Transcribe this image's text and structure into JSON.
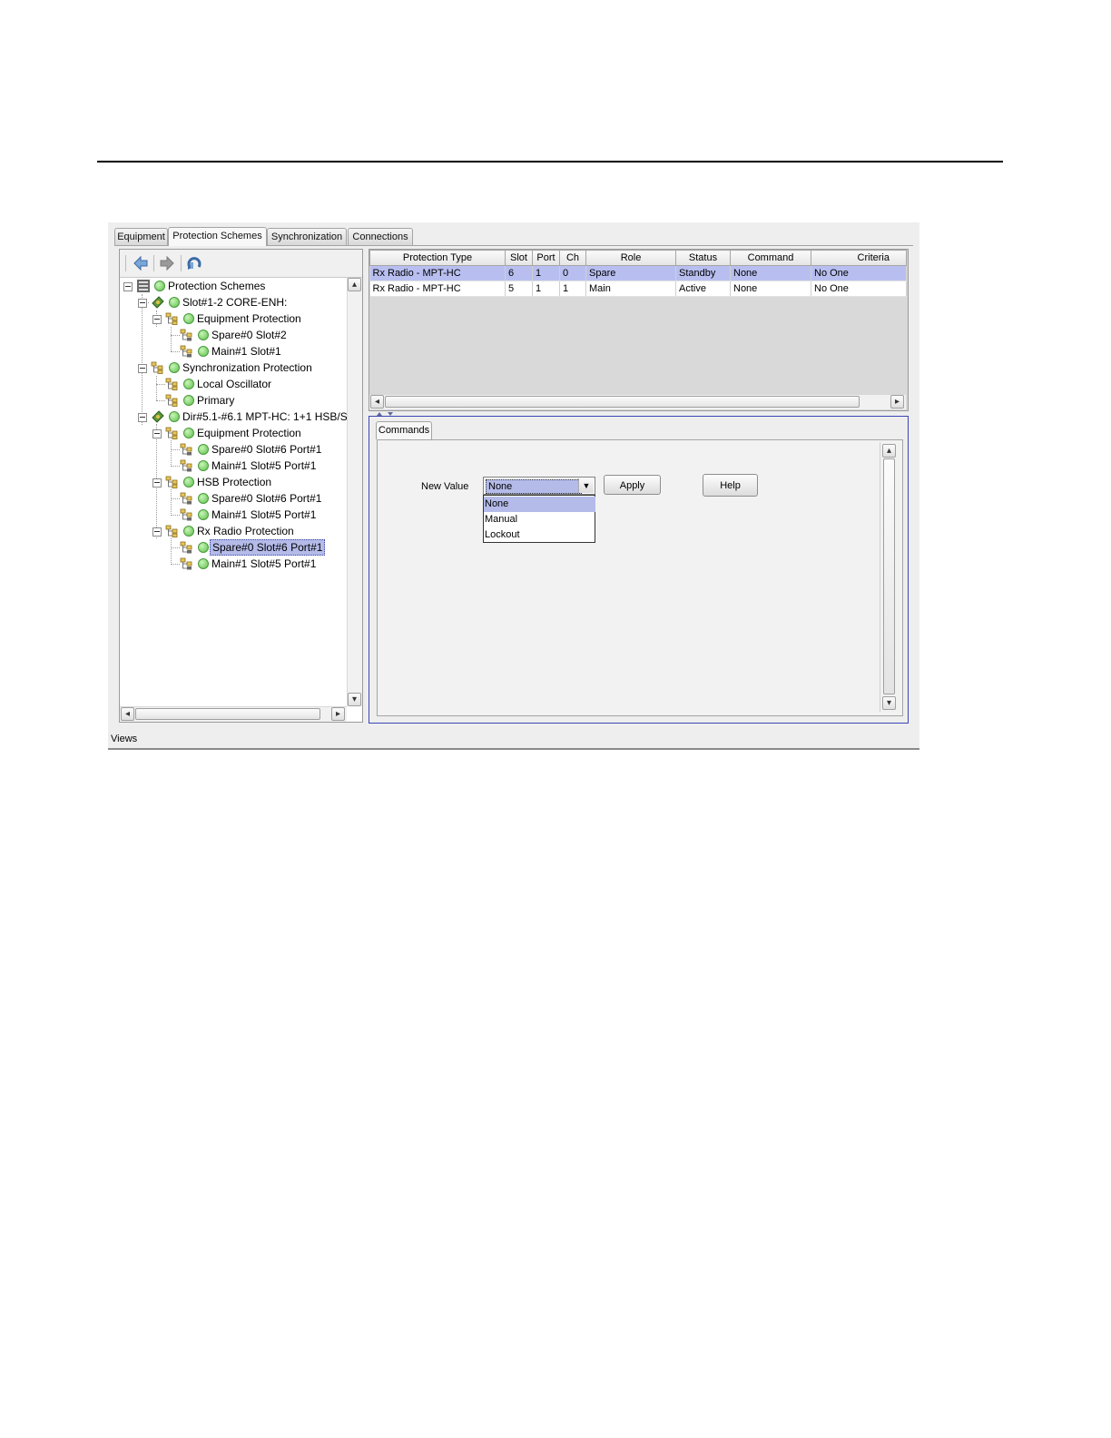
{
  "tabs": [
    "Equipment",
    "Protection Schemes",
    "Synchronization",
    "Connections"
  ],
  "active_tab": "Protection Schemes",
  "tree": {
    "root": "Protection Schemes",
    "nodes": [
      "Slot#1-2  CORE-ENH:",
      "Equipment Protection",
      "Spare#0 Slot#2",
      "Main#1 Slot#1",
      "Synchronization Protection",
      "Local Oscillator",
      "Primary",
      "Dir#5.1-#6.1  MPT-HC: 1+1 HSB/S",
      "Equipment Protection",
      "Spare#0 Slot#6 Port#1",
      "Main#1 Slot#5 Port#1",
      "HSB Protection",
      "Spare#0 Slot#6 Port#1",
      "Main#1 Slot#5 Port#1",
      "Rx Radio Protection",
      "Spare#0 Slot#6 Port#1",
      "Main#1 Slot#5 Port#1"
    ],
    "selected": "Spare#0 Slot#6 Port#1"
  },
  "table": {
    "columns": [
      "Protection Type",
      "Slot",
      "Port",
      "Ch",
      "Role",
      "Status",
      "Command",
      "Criteria"
    ],
    "rows": [
      [
        "Rx Radio - MPT-HC",
        "6",
        "1",
        "0",
        "Spare",
        "Standby",
        "None",
        "No One"
      ],
      [
        "Rx Radio - MPT-HC",
        "5",
        "1",
        "1",
        "Main",
        "Active",
        "None",
        "No One"
      ]
    ]
  },
  "commands": {
    "tab_label": "Commands",
    "new_value_label": "New Value",
    "selected_value": "None",
    "options": [
      "None",
      "Manual",
      "Lockout"
    ],
    "apply_label": "Apply",
    "help_label": "Help"
  },
  "status_bar": "Views",
  "colors": {
    "selection": "#b4bbe9",
    "status_green": "#5cc04a",
    "panel_border": "#3a44b6"
  }
}
